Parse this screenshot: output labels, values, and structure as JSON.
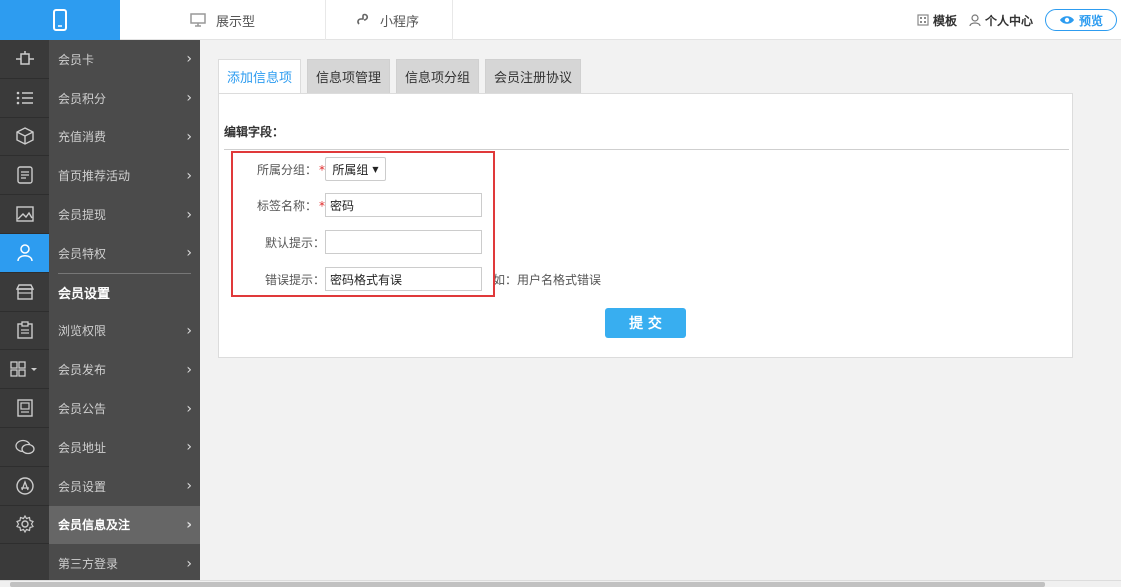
{
  "topbar": {
    "tabs": [
      {
        "label": "展示型",
        "icon": "monitor-icon"
      },
      {
        "label": "小程序",
        "icon": "miniprogram-icon"
      }
    ],
    "template_label": "模板",
    "user_center_label": "个人中心",
    "preview_label": "预览",
    "accent": "#2d9cf0"
  },
  "sidebar": {
    "items": [
      {
        "label": "会员卡",
        "icon": "plugin-icon"
      },
      {
        "label": "会员积分",
        "icon": "list-icon"
      },
      {
        "label": "充值消费",
        "icon": "box-icon"
      },
      {
        "label": "首页推荐活动",
        "icon": "document-icon"
      },
      {
        "label": "会员提现",
        "icon": "image-icon"
      },
      {
        "label": "会员特权",
        "icon": "user-icon"
      },
      {
        "label": "会员设置",
        "icon": "store-icon"
      },
      {
        "label": "浏览权限",
        "icon": "clipboard-icon"
      },
      {
        "label": "会员发布",
        "icon": "grid-icon"
      },
      {
        "label": "会员公告",
        "icon": "notice-icon"
      },
      {
        "label": "会员地址",
        "icon": "chat-icon"
      },
      {
        "label": "会员设置",
        "icon": "appstore-icon"
      },
      {
        "label": "会员信息及注",
        "icon": "gear-icon"
      },
      {
        "label": "第三方登录",
        "icon": ""
      }
    ]
  },
  "main": {
    "tabs": [
      "添加信息项",
      "信息项管理",
      "信息项分组",
      "会员注册协议"
    ],
    "panel_title": "编辑字段：",
    "form": {
      "group_label": "所属分组：",
      "group_value": "所属组",
      "tag_label": "标签名称：",
      "tag_value": "密码",
      "default_label": "默认提示：",
      "default_value": "",
      "error_label": "错误提示：",
      "error_value": "密码格式有误",
      "error_hint": "如：用户名格式错误"
    },
    "submit_label": "提 交"
  }
}
